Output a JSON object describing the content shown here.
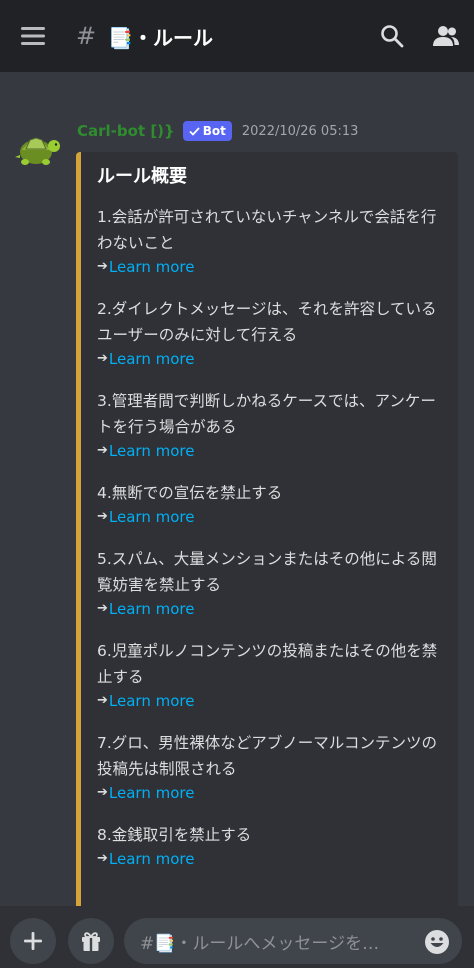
{
  "header": {
    "channel_name": "📑・ルール",
    "hash": "#"
  },
  "message": {
    "author": "Carl-bot [)}",
    "bot_tag": "Bot",
    "timestamp": "2022/10/26 05:13",
    "embed_color": "#d4a33a",
    "embed": {
      "title": "ルール概要",
      "rules": [
        {
          "text": "1.会話が許可されていないチャンネルで会話を行わないこと",
          "link": "Learn more"
        },
        {
          "text": "2.ダイレクトメッセージは、それを許容しているユーザーのみに対して行える",
          "link": "Learn more"
        },
        {
          "text": "3.管理者間で判断しかねるケースでは、アンケートを行う場合がある",
          "link": "Learn more"
        },
        {
          "text": "4.無断での宣伝を禁止する",
          "link": "Learn more"
        },
        {
          "text": "5.スパム、大量メンションまたはその他による閲覧妨害を禁止する",
          "link": "Learn more"
        },
        {
          "text": "6.児童ポルノコンテンツの投稿またはその他を禁止する",
          "link": "Learn more"
        },
        {
          "text": "7.グロ、男性裸体などアブノーマルコンテンツの投稿先は制限される",
          "link": "Learn more"
        },
        {
          "text": "8.金銭取引を禁止する",
          "link": "Learn more"
        }
      ]
    }
  },
  "composer": {
    "placeholder": "#📑・ルールへメッセージを…"
  },
  "colors": {
    "background": "#36393f",
    "topbar": "#202225",
    "link": "#00aff4",
    "bot_tag": "#5865f2",
    "author": "#2f8d2f"
  }
}
